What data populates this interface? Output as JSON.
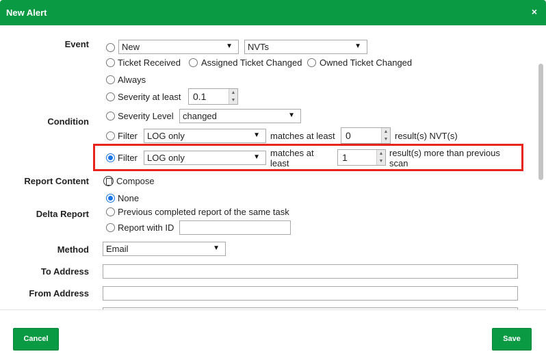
{
  "dialog": {
    "title": "New Alert",
    "close": "×"
  },
  "event": {
    "label": "Event",
    "new_select": "New",
    "nvts_select": "NVTs",
    "ticket_received": "Ticket Received",
    "assigned_ticket_changed": "Assigned Ticket Changed",
    "owned_ticket_changed": "Owned Ticket Changed"
  },
  "condition": {
    "label": "Condition",
    "always": "Always",
    "severity_at_least": "Severity at least",
    "severity_value": "0.1",
    "severity_level": "Severity Level",
    "severity_level_select": "changed",
    "filter1_label": "Filter",
    "filter1_select": "LOG only",
    "filter1_matches": "matches at least",
    "filter1_value": "0",
    "filter1_result": "result(s) NVT(s)",
    "filter2_label": "Filter",
    "filter2_select": "LOG only",
    "filter2_matches_1": "matches at",
    "filter2_matches_2": "least",
    "filter2_value": "1",
    "filter2_result_1": "result(s) more than previous",
    "filter2_result_2": "scan"
  },
  "report_content": {
    "label": "Report Content",
    "compose": "Compose"
  },
  "delta_report": {
    "label": "Delta Report",
    "none": "None",
    "previous": "Previous completed report of the same task",
    "report_with_id": "Report with ID"
  },
  "method": {
    "label": "Method",
    "select": "Email"
  },
  "to_address": {
    "label": "To Address",
    "value": ""
  },
  "from_address": {
    "label": "From Address",
    "value": ""
  },
  "footer": {
    "cancel": "Cancel",
    "save": "Save"
  },
  "colors": {
    "header": "#0a9a44",
    "highlight": "#e8231c",
    "radio_selected": "#1a73e8"
  }
}
